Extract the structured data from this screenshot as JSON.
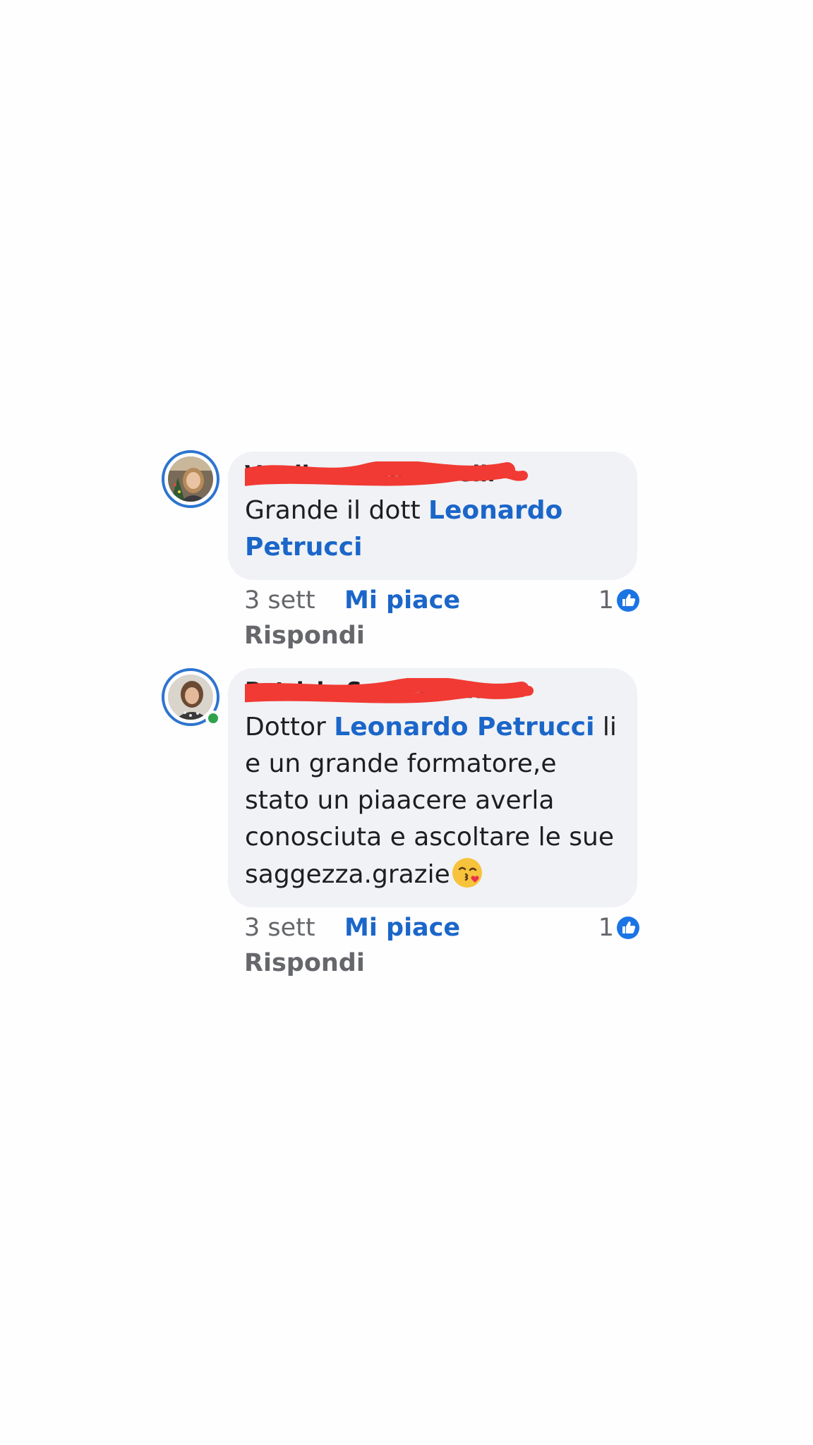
{
  "comments": [
    {
      "author": "Verdiana Tamminelli",
      "text_before": "Grande il dott ",
      "mention": "Leonardo Petrucci",
      "text_after": "",
      "time": "3 sett",
      "like_label": "Mi piace",
      "reply_label": "Rispondi",
      "reaction_count": "1",
      "online": false
    },
    {
      "author": "Patrizia Spaccatella",
      "text_before": "Dottor ",
      "mention": "Leonardo Petrucci",
      "text_after": " li e un grande formatore,e stato un piaacere averla conosciuta e ascoltare le sue saggezza.grazie",
      "time": "3 sett",
      "like_label": "Mi piace",
      "reply_label": "Rispondi",
      "reaction_count": "1",
      "online": true,
      "emoji": "kissing-face-icon"
    }
  ],
  "colors": {
    "bubble": "#f0f2f5",
    "mention": "#1b66c9",
    "avatar_ring": "#2d74cf",
    "online": "#31a24c",
    "redaction": "#f03a33"
  }
}
